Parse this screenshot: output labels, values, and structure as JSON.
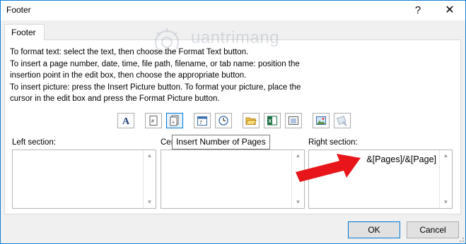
{
  "window": {
    "title": "Footer"
  },
  "title_buttons": {
    "help": "?",
    "close": "✕"
  },
  "tabs": [
    {
      "label": "Footer"
    }
  ],
  "instructions": [
    "To format text:  select the text, then choose the Format Text button.",
    "To insert a page number, date, time, file path, filename, or tab name:  position the",
    "insertion point in the edit box, then choose the appropriate button.",
    "To insert picture: press the Insert Picture button.  To format your picture, place the",
    "cursor in the edit box and press the Format Picture button."
  ],
  "toolbar": [
    {
      "icon": "format-text-icon"
    },
    {
      "icon": "insert-page-number-icon"
    },
    {
      "icon": "insert-number-of-pages-icon"
    },
    {
      "icon": "insert-date-icon"
    },
    {
      "icon": "insert-time-icon"
    },
    {
      "icon": "insert-file-path-icon"
    },
    {
      "icon": "insert-filename-icon"
    },
    {
      "icon": "insert-sheet-name-icon"
    },
    {
      "icon": "insert-picture-icon"
    },
    {
      "icon": "format-picture-icon"
    }
  ],
  "tooltip": "Insert Number of Pages",
  "sections": {
    "left": {
      "label": "Left section:",
      "value": ""
    },
    "center": {
      "label": "Cen",
      "value": ""
    },
    "right": {
      "label": "Right section:",
      "value": "&[Pages]/&[Page]"
    }
  },
  "buttons": {
    "ok": "OK",
    "cancel": "Cancel"
  },
  "watermark": "uantrimang",
  "colors": {
    "accent": "#0078d7",
    "arrow": "#e8161b",
    "window_border": "#1883d7"
  }
}
